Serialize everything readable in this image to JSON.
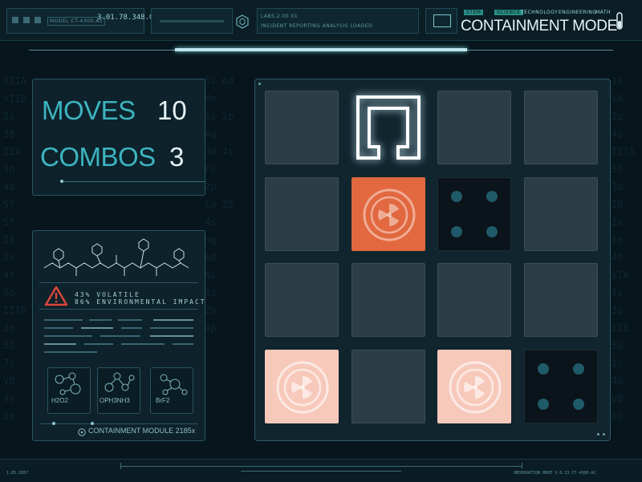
{
  "header": {
    "model_label": "MODEL CT-4300-A1",
    "readout_value": "3.01.78.348.0x",
    "readout_sub": "OBJ STA.SEQ.0001 SECT-09",
    "mid_label_a": "LABS.2.00.01",
    "mid_label_b": "INCIDENT REPORTING    ANALYSIS LOADED",
    "subjects": [
      {
        "label": "STEM",
        "active": false
      },
      {
        "label": "SCIENCE",
        "active": true
      },
      {
        "label": "TECHNOLOGY",
        "active": false
      },
      {
        "label": "ENGINEERING",
        "active": false
      },
      {
        "label": "MATH",
        "active": false
      }
    ],
    "title": "CONTAINMENT MODE",
    "progress": 0.5
  },
  "stats": {
    "moves_label": "MOVES",
    "moves_value": "10",
    "combos_label": "COMBOS",
    "combos_value": "3"
  },
  "info": {
    "volatile_line": "43% VOLATILE",
    "impact_line": "86% ENVIRONMENTAL IMPACT",
    "molecules": [
      {
        "formula": "H2O2"
      },
      {
        "formula": "OPH3NH3"
      },
      {
        "formula": "BrF2"
      }
    ],
    "module_caption": "CONTAINMENT MODULE 2185x"
  },
  "board": {
    "rows": 4,
    "cols": 4,
    "cells": [
      [
        "empty",
        "selector",
        "empty",
        "empty"
      ],
      [
        "empty",
        "hazard-orange",
        "dots-dark",
        "empty"
      ],
      [
        "empty",
        "empty",
        "empty",
        "empty"
      ],
      [
        "hazard-pink",
        "empty",
        "hazard-pink",
        "dots-dark"
      ]
    ]
  },
  "footer": {
    "left": "1.05.2857",
    "right": "OBSERVATION MODE  V.0.13  CT-4300-A1"
  },
  "colors": {
    "accent": "#3db4c0",
    "hazard_orange": "#e2683f",
    "hazard_pink": "#f7c9bb",
    "background": "#07151c"
  }
}
